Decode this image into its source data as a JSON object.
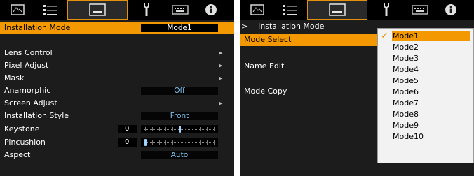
{
  "left_panel": {
    "tabs": [
      {
        "icon": "picture-icon"
      },
      {
        "icon": "adjust-sliders-icon"
      },
      {
        "icon": "installation-screen-icon",
        "active": true
      },
      {
        "icon": "wrench-icon"
      },
      {
        "icon": "keyboard-icon"
      },
      {
        "icon": "info-icon"
      }
    ],
    "menu": {
      "installation_mode": {
        "label": "Installation Mode",
        "value": "Mode1"
      },
      "lens_control": {
        "label": "Lens Control"
      },
      "pixel_adjust": {
        "label": "Pixel Adjust"
      },
      "mask": {
        "label": "Mask"
      },
      "anamorphic": {
        "label": "Anamorphic",
        "value": "Off"
      },
      "screen_adjust": {
        "label": "Screen Adjust"
      },
      "installation_style": {
        "label": "Installation Style",
        "value": "Front"
      },
      "keystone": {
        "label": "Keystone",
        "value": "0",
        "level": 0.5
      },
      "pincushion": {
        "label": "Pincushion",
        "value": "0",
        "level": 0.0
      },
      "aspect": {
        "label": "Aspect",
        "value": "Auto"
      }
    },
    "arrow_glyph": "▶"
  },
  "right_panel": {
    "breadcrumb": {
      "separator": ">",
      "title": "Installation Mode"
    },
    "menu": {
      "mode_select": {
        "label": "Mode Select"
      },
      "name_edit": {
        "label": "Name Edit"
      },
      "mode_copy": {
        "label": "Mode Copy"
      }
    },
    "dropdown": {
      "check_glyph": "✓",
      "options": [
        "Mode1",
        "Mode2",
        "Mode3",
        "Mode4",
        "Mode5",
        "Mode6",
        "Mode7",
        "Mode8",
        "Mode9",
        "Mode10"
      ],
      "selected": "Mode1"
    }
  },
  "colors": {
    "highlight": "#f39800",
    "value_text": "#7ec3ee",
    "panel_bg": "#1c1c1c"
  }
}
